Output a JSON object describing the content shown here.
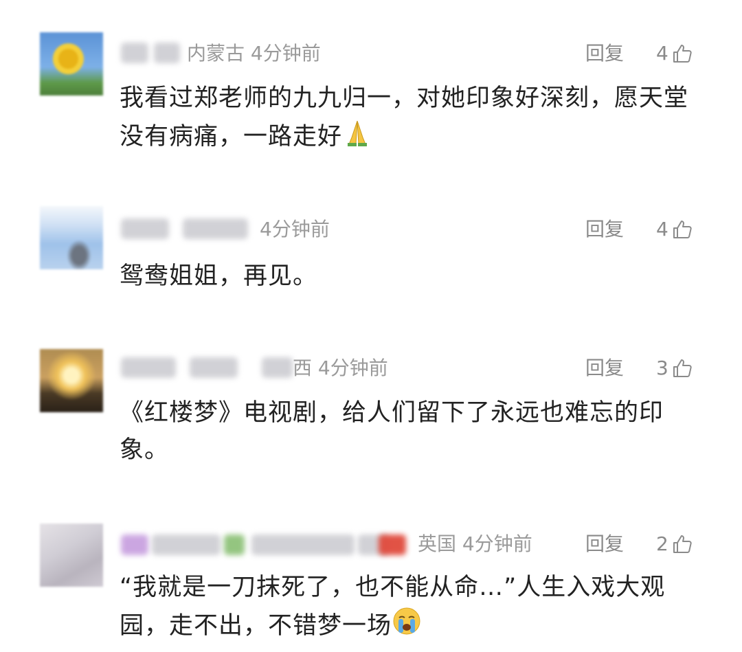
{
  "comments": [
    {
      "location": "内蒙古",
      "time": "4分钟前",
      "reply_label": "回复",
      "likes": "4",
      "text": "我看过郑老师的九九归一，对她印象好深刻，愿天堂没有病痛，一路走好",
      "emoji": "pray-icon"
    },
    {
      "location": "",
      "time": "4分钟前",
      "reply_label": "回复",
      "likes": "4",
      "text": "鸳鸯姐姐，再见。"
    },
    {
      "location": "西",
      "time": "4分钟前",
      "reply_label": "回复",
      "likes": "3",
      "text": "《红楼梦》电视剧，给人们留下了永远也难忘的印象。"
    },
    {
      "location": "英国",
      "time": "4分钟前",
      "reply_label": "回复",
      "likes": "2",
      "text": "“我就是一刀抹死了，也不能从命…”人生入戏大观园，走不出，不错梦一场",
      "emoji": "crying-face-icon"
    }
  ]
}
